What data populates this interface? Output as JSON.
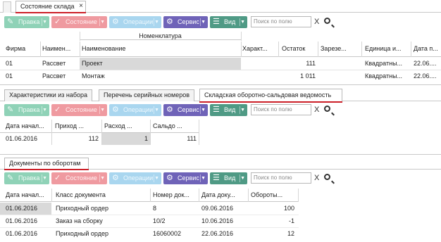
{
  "main_tab": {
    "label": "Состояние склада",
    "close": "×"
  },
  "toolbar": {
    "rights": "Правка",
    "state": "Состояние",
    "operation": "Операции",
    "service": "Сервис",
    "view": "Вид",
    "search_placeholder": "Поиск по полю",
    "clear": "X"
  },
  "grid1": {
    "group_header": "Номенклатура",
    "columns": [
      "Фирма",
      "Наимен...",
      "Наименование",
      "Характ...",
      "Остаток",
      "Зарезе...",
      "Единица и...",
      "Дата п..."
    ],
    "rows": [
      [
        "01",
        "Рассвет",
        "Проект",
        "",
        "111",
        "",
        "Квадратны...",
        "22.06...."
      ],
      [
        "01",
        "Рассвет",
        "Монтаж",
        "",
        "1 011",
        "",
        "Квадратны...",
        "22.06...."
      ]
    ]
  },
  "subtabs": [
    "Характеристики из набора",
    "Перечень серийных номеров",
    "Складская оборотно-сальдовая ведомость"
  ],
  "grid2": {
    "columns": [
      "Дата начал...",
      "Приход ...",
      "Расход ...",
      "Сальдо ..."
    ],
    "rows": [
      [
        "01.06.2016",
        "112",
        "1",
        "111"
      ]
    ]
  },
  "docs_tab": {
    "label": "Документы по оборотам"
  },
  "grid3": {
    "columns": [
      "Дата начал...",
      "Класс документа",
      "Номер док...",
      "Дата доку...",
      "Обороты..."
    ],
    "rows": [
      [
        "01.06.2016",
        "Приходный ордер",
        "8",
        "09.06.2016",
        "100"
      ],
      [
        "01.06.2016",
        "Заказ на сборку",
        "10/2",
        "10.06.2016",
        "-1"
      ],
      [
        "01.06.2016",
        "Приходный ордер",
        "16060002",
        "22.06.2016",
        "12"
      ]
    ]
  }
}
